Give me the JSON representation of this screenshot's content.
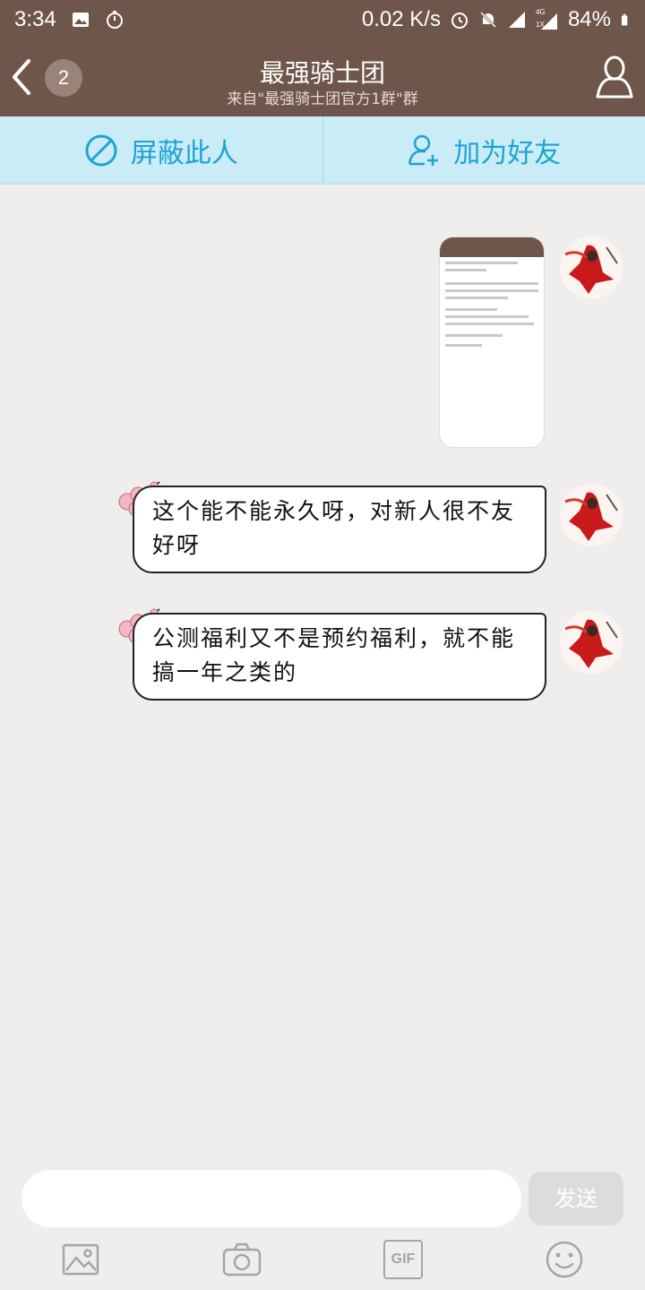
{
  "status_bar": {
    "time": "3:34",
    "net_speed": "0.02 K/s",
    "network_label": "4G",
    "sim_label": "1X",
    "battery": "84%"
  },
  "header": {
    "back_icon": "chevron-left-icon",
    "unread_count": "2",
    "title": "最强骑士团",
    "subtitle": "来自\"最强骑士团官方1群\"群",
    "profile_icon": "user-icon"
  },
  "actions": {
    "block_label": "屏蔽此人",
    "add_friend_label": "加为好友"
  },
  "messages": [
    {
      "type": "image",
      "icon": "screenshot-thumbnail"
    },
    {
      "type": "text",
      "text": "这个能不能永久呀，对新人很不友好呀"
    },
    {
      "type": "text",
      "text": "公测福利又不是预约福利，就不能搞一年之类的"
    }
  ],
  "composer": {
    "placeholder": "",
    "send_label": "发送",
    "gif_label": "GIF"
  },
  "colors": {
    "header_bg": "#6e564a",
    "action_bg": "#c9ecf7",
    "action_text": "#1ea3d4",
    "chat_bg": "#f0eded"
  }
}
